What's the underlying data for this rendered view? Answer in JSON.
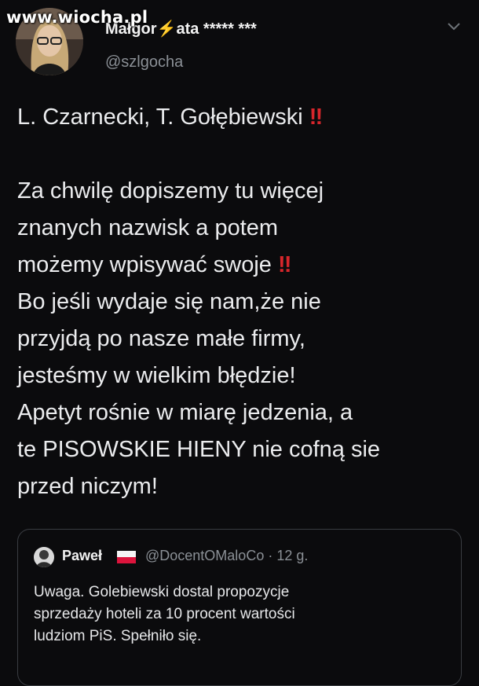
{
  "watermark": "www.wiocha.pl",
  "tweet": {
    "display_name_a": "Małgor",
    "display_name_b": "ata ***** ***",
    "handle": "@szlgocha",
    "lines": [
      {
        "text": "L. Czarnecki, T. Gołębiewski",
        "excl": "‼"
      },
      {
        "text": "",
        "excl": ""
      },
      {
        "text": "Za chwilę dopiszemy tu więcej",
        "excl": ""
      },
      {
        "text": "znanych nazwisk a potem",
        "excl": ""
      },
      {
        "text": "możemy  wpisywać swoje",
        "excl": "‼"
      },
      {
        "text": "Bo jeśli wydaje się nam,że nie",
        "excl": ""
      },
      {
        "text": "przyjdą po nasze małe firmy,",
        "excl": ""
      },
      {
        "text": "jesteśmy w wielkim błędzie!",
        "excl": ""
      },
      {
        "text": "Apetyt rośnie w miarę jedzenia, a",
        "excl": ""
      },
      {
        "text": "te PISOWSKIE HIENY nie cofną sie",
        "excl": ""
      },
      {
        "text": "przed niczym!",
        "excl": ""
      }
    ]
  },
  "quoted_tweet": {
    "name": "Paweł",
    "handle_time": "@DocentOMaloCo · 12 g.",
    "lines": [
      "Uwaga. Golebiewski dostal propozycje",
      "sprzedaży hoteli za 10 procent wartości",
      "ludziom PiS. Spełniło się."
    ]
  },
  "icons": {
    "bolt": "lightning-bolt-emoji",
    "flag": "poland-flag-emoji",
    "menu": "chevron-down-icon"
  },
  "colors": {
    "background": "#0b0b0d",
    "text": "#ebecee",
    "secondary": "#8b9096",
    "exclamation": "#d7262b",
    "border": "#3a3d42"
  }
}
